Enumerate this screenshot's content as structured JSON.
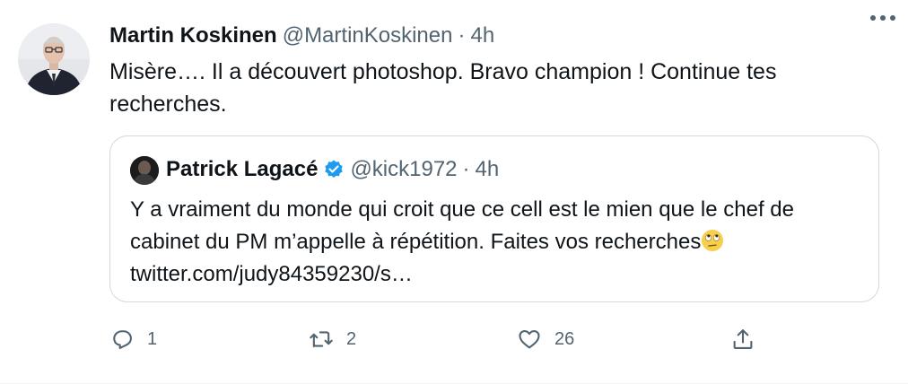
{
  "tweet": {
    "author_name": "Martin Koskinen",
    "author_handle": "@MartinKoskinen",
    "separator": "·",
    "time": "4h",
    "text": "Misère…. Il a découvert photoshop.  Bravo champion !  Continue tes recherches."
  },
  "quoted": {
    "author_name": "Patrick Lagacé",
    "author_handle": "@kick1972",
    "separator": "·",
    "time": "4h",
    "text_line": "Y a vraiment du monde qui croit que ce cell est le mien que le chef de cabinet du PM m’appelle à répétition. Faites vos recherches",
    "link": "twitter.com/judy84359230/s…",
    "verified_icon": "verified-badge-icon",
    "emoji_icon": "face-with-rolling-eyes-emoji"
  },
  "actions": {
    "reply_count": "1",
    "retweet_count": "2",
    "like_count": "26",
    "share_count": ""
  },
  "colors": {
    "text": "#0f1419",
    "secondary": "#536471",
    "border": "#cfd9de",
    "verified": "#1d9bf0"
  }
}
